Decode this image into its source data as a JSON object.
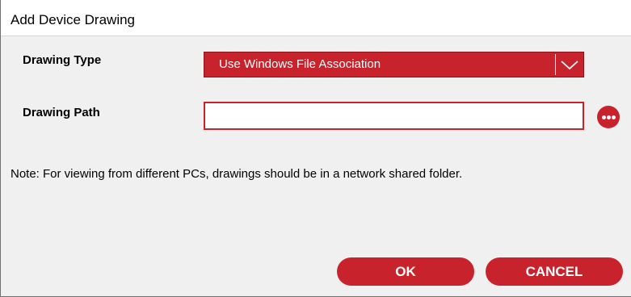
{
  "window": {
    "title": "Add Device Drawing"
  },
  "form": {
    "drawing_type_label": "Drawing Type",
    "drawing_type_value": "Use Windows File Association",
    "drawing_path_label": "Drawing Path",
    "drawing_path_value": ""
  },
  "note": "Note: For viewing from different PCs, drawings should be in a network shared folder.",
  "buttons": {
    "ok_label": "OK",
    "cancel_label": "CANCEL"
  },
  "icons": {
    "dropdown": "chevron-down-icon",
    "browse": "more-horizontal-icon"
  },
  "colors": {
    "accent": "#c8232c",
    "dialog_bg": "#f0f0f0"
  }
}
